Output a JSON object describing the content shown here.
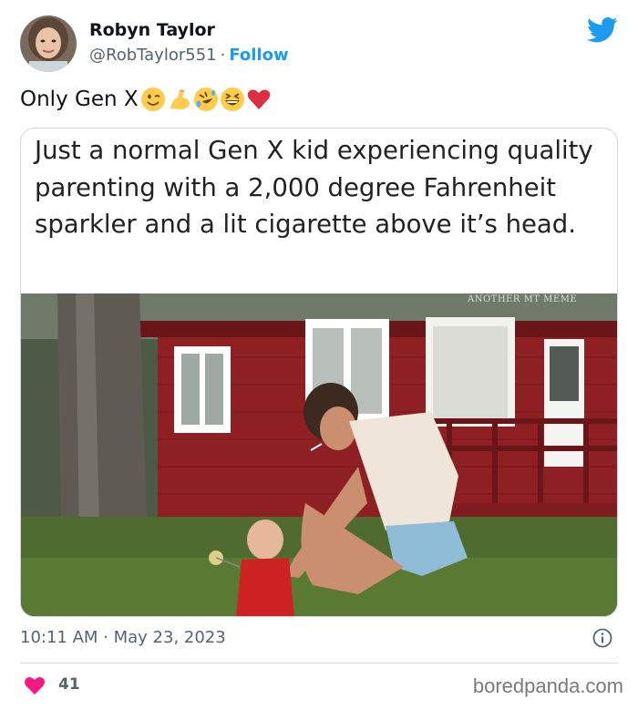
{
  "user": {
    "name": "Robyn Taylor",
    "handle": "@RobTaylor551",
    "separator": "·",
    "follow_label": "Follow",
    "avatar_icon": "profile-photo"
  },
  "brand": {
    "icon": "twitter-bird-icon",
    "color": "#1d9bf0"
  },
  "tweet": {
    "text": "Only Gen X",
    "emojis": [
      "winking-face",
      "flexed-biceps",
      "rolling-on-floor-laughing",
      "grinning-squinting-face",
      "red-heart"
    ]
  },
  "media": {
    "caption": "Just a normal Gen X kid experiencing quality parenting with a 2,000 degree Fahrenheit sparkler and a lit cigarette above it’s head.",
    "watermark": "ANOTHER MT MEME"
  },
  "footer": {
    "timestamp": "10:11 AM · May 23, 2023",
    "info_icon": "info-icon",
    "likes": "41",
    "like_icon": "heart-icon",
    "source": "boredpanda.com"
  },
  "colors": {
    "link": "#1d9bf0",
    "heart": "#f91880",
    "muted": "#536471"
  }
}
